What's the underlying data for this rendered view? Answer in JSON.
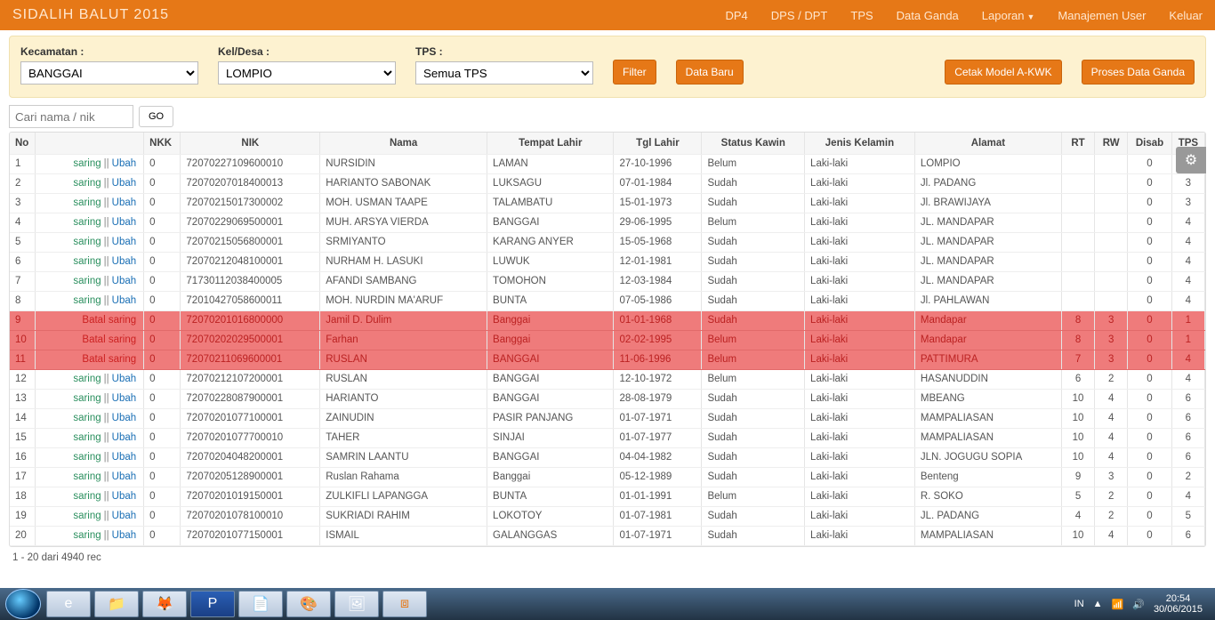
{
  "brand": "SIDALIH BALUT 2015",
  "nav": {
    "dp4": "DP4",
    "dpsdpt": "DPS / DPT",
    "tps": "TPS",
    "ganda": "Data Ganda",
    "laporan": "Laporan",
    "user": "Manajemen User",
    "keluar": "Keluar"
  },
  "filters": {
    "kecamatan_label": "Kecamatan :",
    "kecamatan_value": "BANGGAI",
    "keldesa_label": "Kel/Desa :",
    "keldesa_value": "LOMPIO",
    "tps_label": "TPS :",
    "tps_value": "Semua TPS",
    "btn_filter": "Filter",
    "btn_baru": "Data Baru",
    "btn_cetak": "Cetak Model A-KWK",
    "btn_proses": "Proses Data Ganda"
  },
  "search": {
    "placeholder": "Cari nama / nik",
    "go": "GO"
  },
  "headers": {
    "no": "No",
    "act": "",
    "nkk": "NKK",
    "nik": "NIK",
    "nama": "Nama",
    "tempat": "Tempat Lahir",
    "tgl": "Tgl Lahir",
    "status": "Status Kawin",
    "jk": "Jenis Kelamin",
    "alamat": "Alamat",
    "rt": "RT",
    "rw": "RW",
    "disab": "Disab",
    "tps": "TPS"
  },
  "link_labels": {
    "saring": "saring",
    "ubah": "Ubah",
    "batal": "Batal saring"
  },
  "rows": [
    {
      "no": "1",
      "hl": false,
      "act": "su",
      "nkk": "0",
      "nik": "72070227109600010",
      "nama": "NURSIDIN",
      "tempat": "LAMAN",
      "tgl": "27-10-1996",
      "status": "Belum",
      "jk": "Laki-laki",
      "alamat": "LOMPIO",
      "rt": "",
      "rw": "",
      "disab": "0",
      "tps": ""
    },
    {
      "no": "2",
      "hl": false,
      "act": "su",
      "nkk": "0",
      "nik": "72070207018400013",
      "nama": "HARIANTO SABONAK",
      "tempat": "LUKSAGU",
      "tgl": "07-01-1984",
      "status": "Sudah",
      "jk": "Laki-laki",
      "alamat": "Jl. PADANG",
      "rt": "",
      "rw": "",
      "disab": "0",
      "tps": "3"
    },
    {
      "no": "3",
      "hl": false,
      "act": "su",
      "nkk": "0",
      "nik": "72070215017300002",
      "nama": "MOH. USMAN TAAPE",
      "tempat": "TALAMBATU",
      "tgl": "15-01-1973",
      "status": "Sudah",
      "jk": "Laki-laki",
      "alamat": "Jl. BRAWIJAYA",
      "rt": "",
      "rw": "",
      "disab": "0",
      "tps": "3"
    },
    {
      "no": "4",
      "hl": false,
      "act": "su",
      "nkk": "0",
      "nik": "72070229069500001",
      "nama": "MUH. ARSYA VIERDA",
      "tempat": "BANGGAI",
      "tgl": "29-06-1995",
      "status": "Belum",
      "jk": "Laki-laki",
      "alamat": "JL. MANDAPAR",
      "rt": "",
      "rw": "",
      "disab": "0",
      "tps": "4"
    },
    {
      "no": "5",
      "hl": false,
      "act": "su",
      "nkk": "0",
      "nik": "72070215056800001",
      "nama": "SRMIYANTO",
      "tempat": "KARANG ANYER",
      "tgl": "15-05-1968",
      "status": "Sudah",
      "jk": "Laki-laki",
      "alamat": "JL. MANDAPAR",
      "rt": "",
      "rw": "",
      "disab": "0",
      "tps": "4"
    },
    {
      "no": "6",
      "hl": false,
      "act": "su",
      "nkk": "0",
      "nik": "72070212048100001",
      "nama": "NURHAM H. LASUKI",
      "tempat": "LUWUK",
      "tgl": "12-01-1981",
      "status": "Sudah",
      "jk": "Laki-laki",
      "alamat": "JL. MANDAPAR",
      "rt": "",
      "rw": "",
      "disab": "0",
      "tps": "4"
    },
    {
      "no": "7",
      "hl": false,
      "act": "su",
      "nkk": "0",
      "nik": "71730112038400005",
      "nama": "AFANDI SAMBANG",
      "tempat": "TOMOHON",
      "tgl": "12-03-1984",
      "status": "Sudah",
      "jk": "Laki-laki",
      "alamat": "JL. MANDAPAR",
      "rt": "",
      "rw": "",
      "disab": "0",
      "tps": "4"
    },
    {
      "no": "8",
      "hl": false,
      "act": "su",
      "nkk": "0",
      "nik": "72010427058600011",
      "nama": "MOH. NURDIN MA'ARUF",
      "tempat": "BUNTA",
      "tgl": "07-05-1986",
      "status": "Sudah",
      "jk": "Laki-laki",
      "alamat": "Jl. PAHLAWAN",
      "rt": "",
      "rw": "",
      "disab": "0",
      "tps": "4"
    },
    {
      "no": "9",
      "hl": true,
      "act": "b",
      "nkk": "0",
      "nik": "72070201016800000",
      "nama": "Jamil D. Dulim",
      "tempat": "Banggai",
      "tgl": "01-01-1968",
      "status": "Sudah",
      "jk": "Laki-laki",
      "alamat": "Mandapar",
      "rt": "8",
      "rw": "3",
      "disab": "0",
      "tps": "1"
    },
    {
      "no": "10",
      "hl": true,
      "act": "b",
      "nkk": "0",
      "nik": "72070202029500001",
      "nama": "Farhan",
      "tempat": "Banggai",
      "tgl": "02-02-1995",
      "status": "Belum",
      "jk": "Laki-laki",
      "alamat": "Mandapar",
      "rt": "8",
      "rw": "3",
      "disab": "0",
      "tps": "1"
    },
    {
      "no": "11",
      "hl": true,
      "act": "b",
      "nkk": "0",
      "nik": "72070211069600001",
      "nama": "RUSLAN",
      "tempat": "BANGGAI",
      "tgl": "11-06-1996",
      "status": "Belum",
      "jk": "Laki-laki",
      "alamat": "PATTIMURA",
      "rt": "7",
      "rw": "3",
      "disab": "0",
      "tps": "4"
    },
    {
      "no": "12",
      "hl": false,
      "act": "su",
      "nkk": "0",
      "nik": "72070212107200001",
      "nama": "RUSLAN",
      "tempat": "BANGGAI",
      "tgl": "12-10-1972",
      "status": "Belum",
      "jk": "Laki-laki",
      "alamat": "HASANUDDIN",
      "rt": "6",
      "rw": "2",
      "disab": "0",
      "tps": "4"
    },
    {
      "no": "13",
      "hl": false,
      "act": "su",
      "nkk": "0",
      "nik": "72070228087900001",
      "nama": "HARIANTO",
      "tempat": "BANGGAI",
      "tgl": "28-08-1979",
      "status": "Sudah",
      "jk": "Laki-laki",
      "alamat": "MBEANG",
      "rt": "10",
      "rw": "4",
      "disab": "0",
      "tps": "6"
    },
    {
      "no": "14",
      "hl": false,
      "act": "su",
      "nkk": "0",
      "nik": "72070201077100001",
      "nama": "ZAINUDIN",
      "tempat": "PASIR PANJANG",
      "tgl": "01-07-1971",
      "status": "Sudah",
      "jk": "Laki-laki",
      "alamat": "MAMPALIASAN",
      "rt": "10",
      "rw": "4",
      "disab": "0",
      "tps": "6"
    },
    {
      "no": "15",
      "hl": false,
      "act": "su",
      "nkk": "0",
      "nik": "72070201077700010",
      "nama": "TAHER",
      "tempat": "SINJAI",
      "tgl": "01-07-1977",
      "status": "Sudah",
      "jk": "Laki-laki",
      "alamat": "MAMPALIASAN",
      "rt": "10",
      "rw": "4",
      "disab": "0",
      "tps": "6"
    },
    {
      "no": "16",
      "hl": false,
      "act": "su",
      "nkk": "0",
      "nik": "72070204048200001",
      "nama": "SAMRIN LAANTU",
      "tempat": "BANGGAI",
      "tgl": "04-04-1982",
      "status": "Sudah",
      "jk": "Laki-laki",
      "alamat": "JLN. JOGUGU SOPIA",
      "rt": "10",
      "rw": "4",
      "disab": "0",
      "tps": "6"
    },
    {
      "no": "17",
      "hl": false,
      "act": "su",
      "nkk": "0",
      "nik": "72070205128900001",
      "nama": "Ruslan Rahama",
      "tempat": "Banggai",
      "tgl": "05-12-1989",
      "status": "Sudah",
      "jk": "Laki-laki",
      "alamat": "Benteng",
      "rt": "9",
      "rw": "3",
      "disab": "0",
      "tps": "2"
    },
    {
      "no": "18",
      "hl": false,
      "act": "su",
      "nkk": "0",
      "nik": "72070201019150001",
      "nama": "ZULKIFLI LAPANGGA",
      "tempat": "BUNTA",
      "tgl": "01-01-1991",
      "status": "Belum",
      "jk": "Laki-laki",
      "alamat": "R. SOKO",
      "rt": "5",
      "rw": "2",
      "disab": "0",
      "tps": "4"
    },
    {
      "no": "19",
      "hl": false,
      "act": "su",
      "nkk": "0",
      "nik": "72070201078100010",
      "nama": "SUKRIADI RAHIM",
      "tempat": "LOKOTOY",
      "tgl": "01-07-1981",
      "status": "Sudah",
      "jk": "Laki-laki",
      "alamat": "JL. PADANG",
      "rt": "4",
      "rw": "2",
      "disab": "0",
      "tps": "5"
    },
    {
      "no": "20",
      "hl": false,
      "act": "su",
      "nkk": "0",
      "nik": "72070201077150001",
      "nama": "ISMAIL",
      "tempat": "GALANGGAS",
      "tgl": "01-07-1971",
      "status": "Sudah",
      "jk": "Laki-laki",
      "alamat": "MAMPALIASAN",
      "rt": "10",
      "rw": "4",
      "disab": "0",
      "tps": "6"
    }
  ],
  "footer_rec": "1 - 20 dari 4940 rec",
  "taskbar": {
    "lang": "IN",
    "time": "20:54",
    "date": "30/06/2015"
  }
}
